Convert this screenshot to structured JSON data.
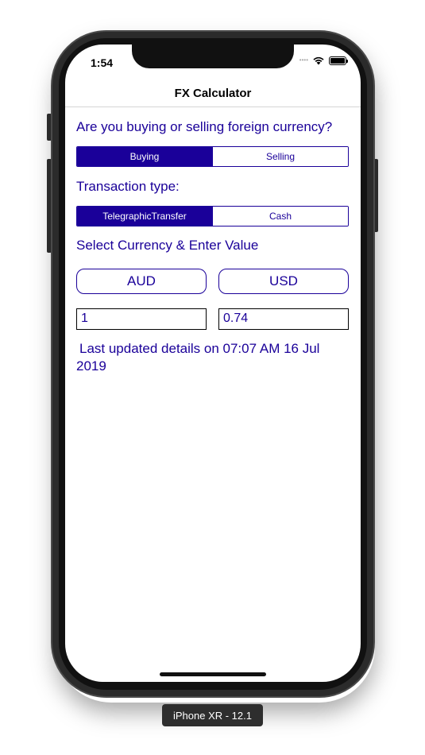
{
  "status_bar": {
    "time": "1:54"
  },
  "nav": {
    "title": "FX Calculator"
  },
  "buy_sell": {
    "question": "Are you buying or selling foreign currency?",
    "options": [
      "Buying",
      "Selling"
    ],
    "selected": "Buying"
  },
  "transaction": {
    "label": "Transaction type:",
    "options": [
      "TelegraphicTransfer",
      "Cash"
    ],
    "selected": "TelegraphicTransfer"
  },
  "currency": {
    "label": "Select Currency & Enter Value",
    "from_currency": "AUD",
    "to_currency": "USD",
    "from_value": "1",
    "to_value": "0.74"
  },
  "last_updated": "Last updated details on 07:07 AM 16 Jul 2019",
  "device_label": "iPhone XR - 12.1",
  "colors": {
    "accent": "#1a0099"
  }
}
